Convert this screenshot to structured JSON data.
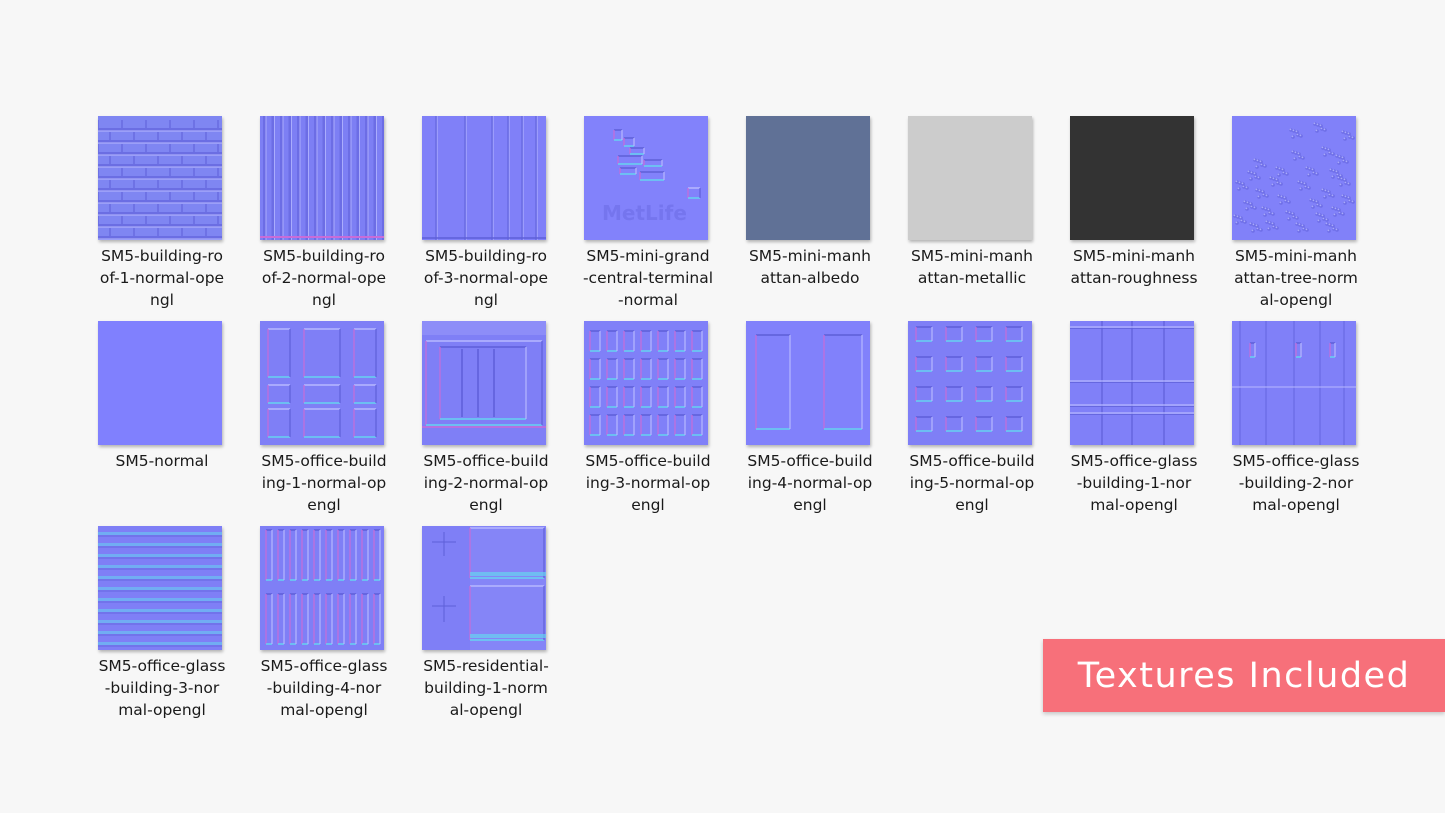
{
  "textures": [
    {
      "label": "SM5-building-ro\nof-1-normal-ope\nngl",
      "preview": "roof-tiles",
      "colors": {
        "base": "#7f86f2"
      }
    },
    {
      "label": "SM5-building-ro\nof-2-normal-ope\nngl",
      "preview": "vertical-ribs",
      "colors": {
        "base": "#7d7ff4"
      }
    },
    {
      "label": "SM5-building-ro\nof-3-normal-ope\nngl",
      "preview": "vertical-panels",
      "colors": {
        "base": "#8080f8"
      }
    },
    {
      "label": "SM5-mini-grand\n-central-terminal\n-normal",
      "preview": "terminal",
      "colors": {
        "base": "#8282fb"
      }
    },
    {
      "label": "SM5-mini-manh\nattan-albedo",
      "preview": "flat",
      "colors": {
        "base": "#607196"
      }
    },
    {
      "label": "SM5-mini-manh\nattan-metallic",
      "preview": "flat",
      "colors": {
        "base": "#cccccc"
      }
    },
    {
      "label": "SM5-mini-manh\nattan-roughness",
      "preview": "flat",
      "colors": {
        "base": "#333333"
      }
    },
    {
      "label": "SM5-mini-manh\nattan-tree-norm\nal-opengl",
      "preview": "trees",
      "colors": {
        "base": "#8181f9"
      }
    },
    {
      "label": "SM5-normal",
      "preview": "flat",
      "colors": {
        "base": "#8080fe"
      }
    },
    {
      "label": "SM5-office-build\ning-1-normal-op\nengl",
      "preview": "doors",
      "colors": {
        "base": "#7f7ff6"
      }
    },
    {
      "label": "SM5-office-build\ning-2-normal-op\nengl",
      "preview": "window-frame",
      "colors": {
        "base": "#7f7ff6"
      }
    },
    {
      "label": "SM5-office-build\ning-3-normal-op\nengl",
      "preview": "window-grid",
      "colors": {
        "base": "#8080f8"
      }
    },
    {
      "label": "SM5-office-build\ning-4-normal-op\nengl",
      "preview": "two-panels",
      "colors": {
        "base": "#8181fb"
      }
    },
    {
      "label": "SM5-office-build\ning-5-normal-op\nengl",
      "preview": "square-windows",
      "colors": {
        "base": "#7f7ff6"
      }
    },
    {
      "label": "SM5-office-glass\n-building-1-nor\nmal-opengl",
      "preview": "glass-grid",
      "colors": {
        "base": "#8080f8"
      }
    },
    {
      "label": "SM5-office-glass\n-building-2-nor\nmal-opengl",
      "preview": "glass-slits",
      "colors": {
        "base": "#8080f8"
      }
    },
    {
      "label": "SM5-office-glass\n-building-3-nor\nmal-opengl",
      "preview": "horizontal-bands",
      "colors": {
        "base": "#7f7ff6"
      }
    },
    {
      "label": "SM5-office-glass\n-building-4-nor\nmal-opengl",
      "preview": "vertical-slats",
      "colors": {
        "base": "#7f7ff6"
      }
    },
    {
      "label": "SM5-residential-\nbuilding-1-norm\nal-opengl",
      "preview": "residential",
      "colors": {
        "base": "#7f7ff6"
      }
    }
  ],
  "banner": {
    "text": "Textures Included",
    "color": "#f7707a"
  },
  "colors": {
    "hi": "#b7b8ff",
    "lo": "#5e5fd8",
    "cyan": "#66d3f0",
    "pink": "#c86cd8"
  }
}
